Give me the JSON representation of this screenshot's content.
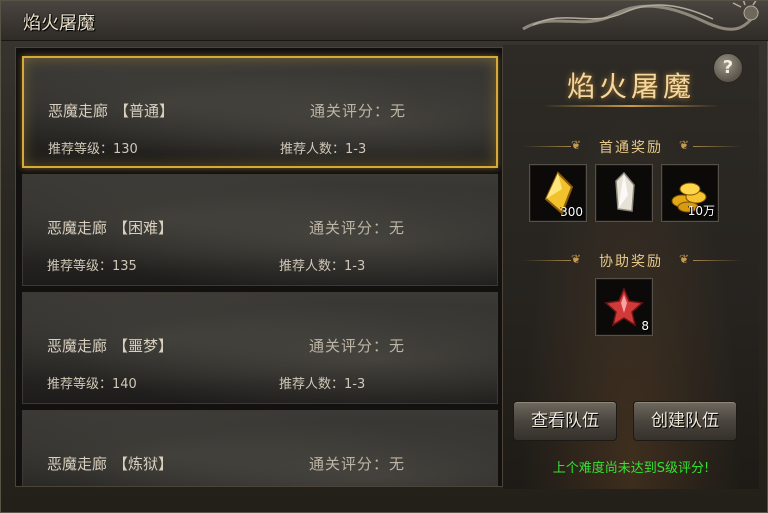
{
  "window": {
    "title": "焰火屠魔"
  },
  "levels": [
    {
      "name": "恶魔走廊",
      "difficulty": "【普通】",
      "score_label": "通关评分：无",
      "rec_level": "推荐等级：130",
      "rec_players": "推荐人数：1-3",
      "selected": true
    },
    {
      "name": "恶魔走廊",
      "difficulty": "【困难】",
      "score_label": "通关评分：无",
      "rec_level": "推荐等级：135",
      "rec_players": "推荐人数：1-3",
      "selected": false
    },
    {
      "name": "恶魔走廊",
      "difficulty": "【噩梦】",
      "score_label": "通关评分：无",
      "rec_level": "推荐等级：140",
      "rec_players": "推荐人数：1-3",
      "selected": false
    },
    {
      "name": "恶魔走廊",
      "difficulty": "【炼狱】",
      "score_label": "通关评分：无",
      "rec_level": "",
      "rec_players": "",
      "selected": false
    }
  ],
  "side": {
    "help_icon": "?",
    "boss_title": "焰火屠魔",
    "first_clear_title": "首通奖励",
    "first_clear_rewards": [
      {
        "icon": "yellow-gem-icon",
        "count": "300"
      },
      {
        "icon": "crystal-shard-icon",
        "count": ""
      },
      {
        "icon": "gold-coins-icon",
        "count": "10万"
      }
    ],
    "assist_title": "协助奖励",
    "assist_rewards": [
      {
        "icon": "red-star-icon",
        "count": "8"
      }
    ],
    "view_team_label": "查看队伍",
    "create_team_label": "创建队伍",
    "hint": "上个难度尚未达到S级评分!"
  },
  "colors": {
    "selected_border": "#d7a93a",
    "hint": "#33e233",
    "gold_text": "#f3d9a0"
  }
}
